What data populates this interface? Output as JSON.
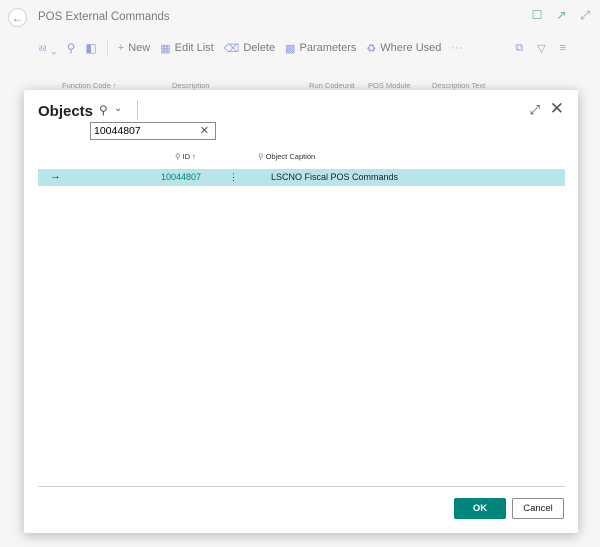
{
  "page": {
    "title": "POS External Commands",
    "toolbar": {
      "new_label": "New",
      "edit_list_label": "Edit List",
      "delete_label": "Delete",
      "parameters_label": "Parameters",
      "where_used_label": "Where Used",
      "more_label": "···"
    },
    "list_columns": [
      "Function Code ↑",
      "Description",
      "Run Codeunit",
      "POS Module",
      "Description Text"
    ]
  },
  "dialog": {
    "title": "Objects",
    "search_value": "10044807",
    "columns": {
      "id": "ID ↑",
      "caption": "Object Caption"
    },
    "rows": [
      {
        "id": "10044807",
        "caption": "LSCNO Fiscal POS Commands"
      }
    ],
    "ok_label": "OK",
    "cancel_label": "Cancel"
  },
  "icons": {
    "back": "back-arrow-icon",
    "bookmark": "bookmark-icon",
    "share": "open-in-new-icon",
    "expand": "expand-icon",
    "close": "close-icon",
    "search": "search-icon",
    "row_arrow": "row-arrow-icon"
  },
  "colors": {
    "accent": "#00857a",
    "selected_row": "#b8e5e9",
    "toolbar_icon": "#5b6ad0"
  }
}
